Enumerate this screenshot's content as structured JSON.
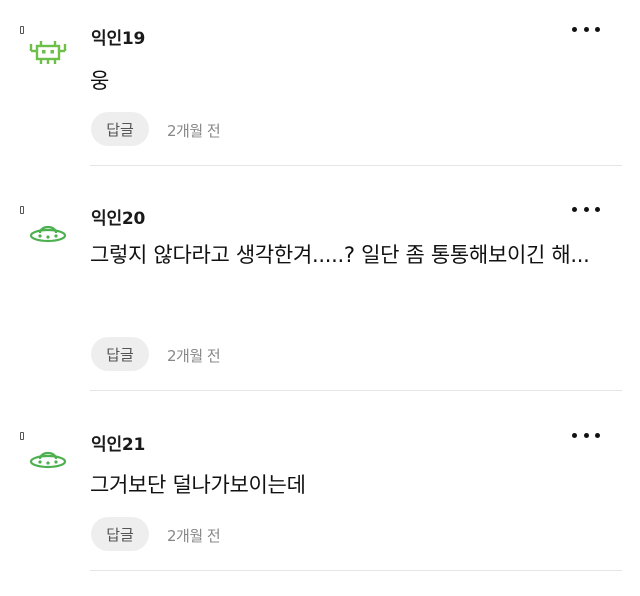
{
  "comments": [
    {
      "username": "익인19",
      "avatar_icon": "pixel-invader-icon",
      "avatar_color": "#6cc04a",
      "text": "웅",
      "reply_label": "답글",
      "time": "2개월 전",
      "more_icon": "more-options-icon"
    },
    {
      "username": "익인20",
      "avatar_icon": "ufo-icon",
      "avatar_color": "#4caf50",
      "text": "그렇지 않다라고 생각한겨.....? 일단 좀 통통해보이긴 해...",
      "reply_label": "답글",
      "time": "2개월 전",
      "more_icon": "more-options-icon"
    },
    {
      "username": "익인21",
      "avatar_icon": "ufo-icon",
      "avatar_color": "#4caf50",
      "text": "그거보단 덜나가보이는데",
      "reply_label": "답글",
      "time": "2개월 전",
      "more_icon": "more-options-icon"
    }
  ]
}
